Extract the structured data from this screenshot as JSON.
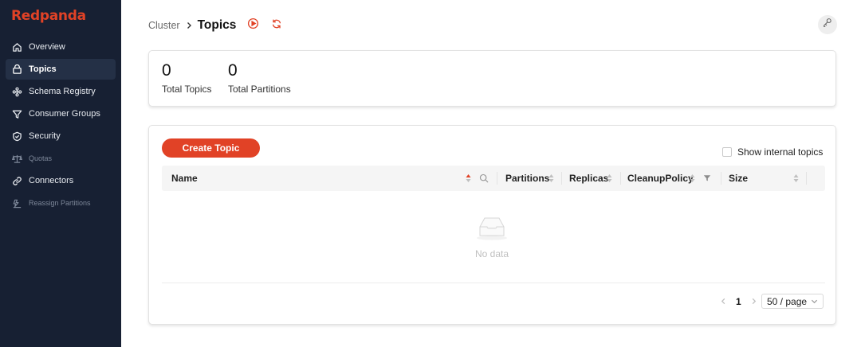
{
  "app": {
    "brand": "Redpanda",
    "accent": "#e14226",
    "sidebar_bg": "#172033"
  },
  "sidebar": {
    "items": [
      {
        "label": "Overview",
        "icon": "home-icon"
      },
      {
        "label": "Topics",
        "icon": "topics-icon",
        "active": true
      },
      {
        "label": "Schema Registry",
        "icon": "schema-icon"
      },
      {
        "label": "Consumer Groups",
        "icon": "funnel-icon"
      },
      {
        "label": "Security",
        "icon": "shield-icon"
      },
      {
        "label": "Quotas",
        "icon": "scale-icon",
        "disabled": true
      },
      {
        "label": "Connectors",
        "icon": "link-icon"
      },
      {
        "label": "Reassign Partitions",
        "icon": "reassign-icon",
        "disabled": true
      }
    ]
  },
  "header": {
    "breadcrumb_parent": "Cluster",
    "title": "Topics",
    "icons": [
      "play-circle-icon",
      "refresh-icon",
      "user-settings-icon"
    ]
  },
  "stats": [
    {
      "value": "0",
      "label": "Total Topics"
    },
    {
      "value": "0",
      "label": "Total Partitions"
    }
  ],
  "toolbar": {
    "create_label": "Create Topic",
    "show_internal_label": "Show internal topics",
    "show_internal_checked": false
  },
  "table": {
    "columns": [
      "Name",
      "Partitions",
      "Replicas",
      "CleanupPolicy",
      "Size"
    ],
    "rows": [],
    "empty_text": "No data"
  },
  "pagination": {
    "current_page": "1",
    "page_size": "50 / page"
  }
}
